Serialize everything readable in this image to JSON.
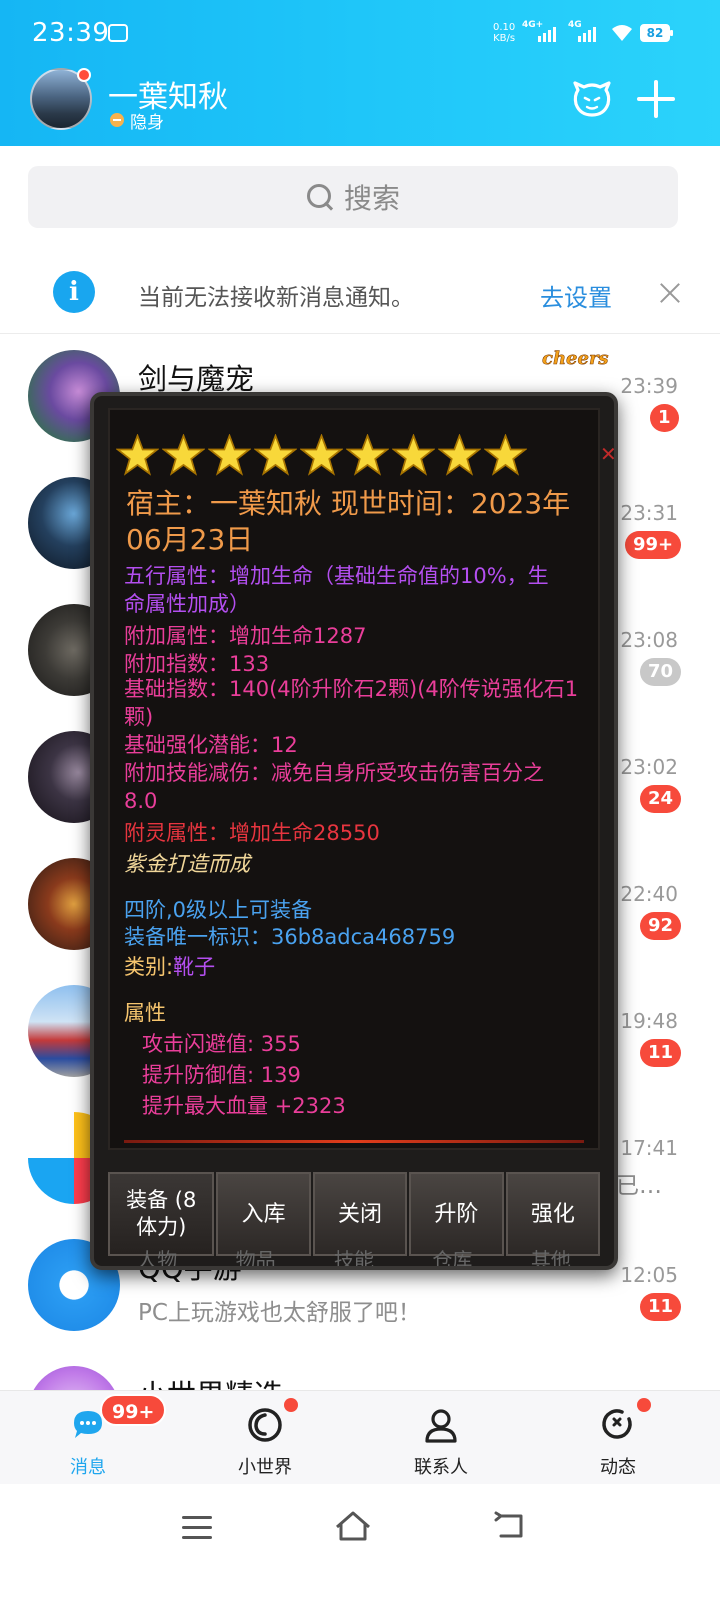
{
  "status_bar": {
    "time": "23:39",
    "speed_value": "0.10",
    "speed_unit": "KB/s",
    "net1": "4G+",
    "net2": "4G",
    "battery": "82"
  },
  "header": {
    "nickname": "一葉知秋",
    "status": "隐身"
  },
  "search": {
    "placeholder": "搜索"
  },
  "notice": {
    "text": "当前无法接收新消息通知。",
    "link": "去设置"
  },
  "conversations": [
    {
      "title": "剑与魔宠",
      "preview": "",
      "time": "23:39",
      "badge": "1",
      "tag": "cheers"
    },
    {
      "title": "",
      "preview": "",
      "time": "23:31",
      "badge": "99+"
    },
    {
      "title": "",
      "preview": "",
      "time": "23:08",
      "badge": "70"
    },
    {
      "title": "",
      "preview": "",
      "time": "23:02",
      "badge": "24"
    },
    {
      "title": "",
      "preview": "",
      "time": "22:40",
      "badge": "92"
    },
    {
      "title": "",
      "preview": "",
      "time": "19:48",
      "badge": "11"
    },
    {
      "title": "",
      "preview": "已…",
      "time": "17:41",
      "badge": ""
    },
    {
      "title": "QQ手游",
      "preview": "PC上玩游戏也太舒服了吧！",
      "time": "12:05",
      "badge": "11"
    },
    {
      "title": "小世界精选",
      "preview": "",
      "time": "",
      "badge": ""
    }
  ],
  "item_popup": {
    "star_count": 9,
    "owner_line": "宿主：一葉知秋 现世时间：2023年06月23日",
    "wuxing": "五行属性：增加生命（基础生命值的10%，生命属性加成）",
    "extra_attr": "附加属性：增加生命1287",
    "extra_index": "附加指数：133",
    "base_index": "基础指数：140(4阶升阶石2颗)(4阶传说强化石1颗)",
    "base_potential": "基础强化潜能：12",
    "skill_reduce": "附加技能减伤：减免自身所受攻击伤害百分之8.0",
    "spirit_attr": "附灵属性：增加生命28550",
    "forged": "紫金打造而成",
    "equip_req": "四阶,0级以上可装备",
    "equip_id": "装备唯一标识：36b8adca468759",
    "category_label": "类别:",
    "category_value": "靴子",
    "attr_header": "属性",
    "attrs": [
      "攻击闪避值: 355",
      "提升防御值: 139",
      "提升最大血量 +2323"
    ],
    "buttons": {
      "equip": "装备 (8体力)",
      "store": "入库",
      "close": "关闭",
      "upgrade": "升阶",
      "enhance": "强化"
    },
    "under_tabs": [
      "人物",
      "物品",
      "技能",
      "仓库",
      "其他"
    ]
  },
  "bottom_nav": {
    "items": [
      "消息",
      "小世界",
      "联系人",
      "动态"
    ],
    "messages_badge": "99+"
  }
}
